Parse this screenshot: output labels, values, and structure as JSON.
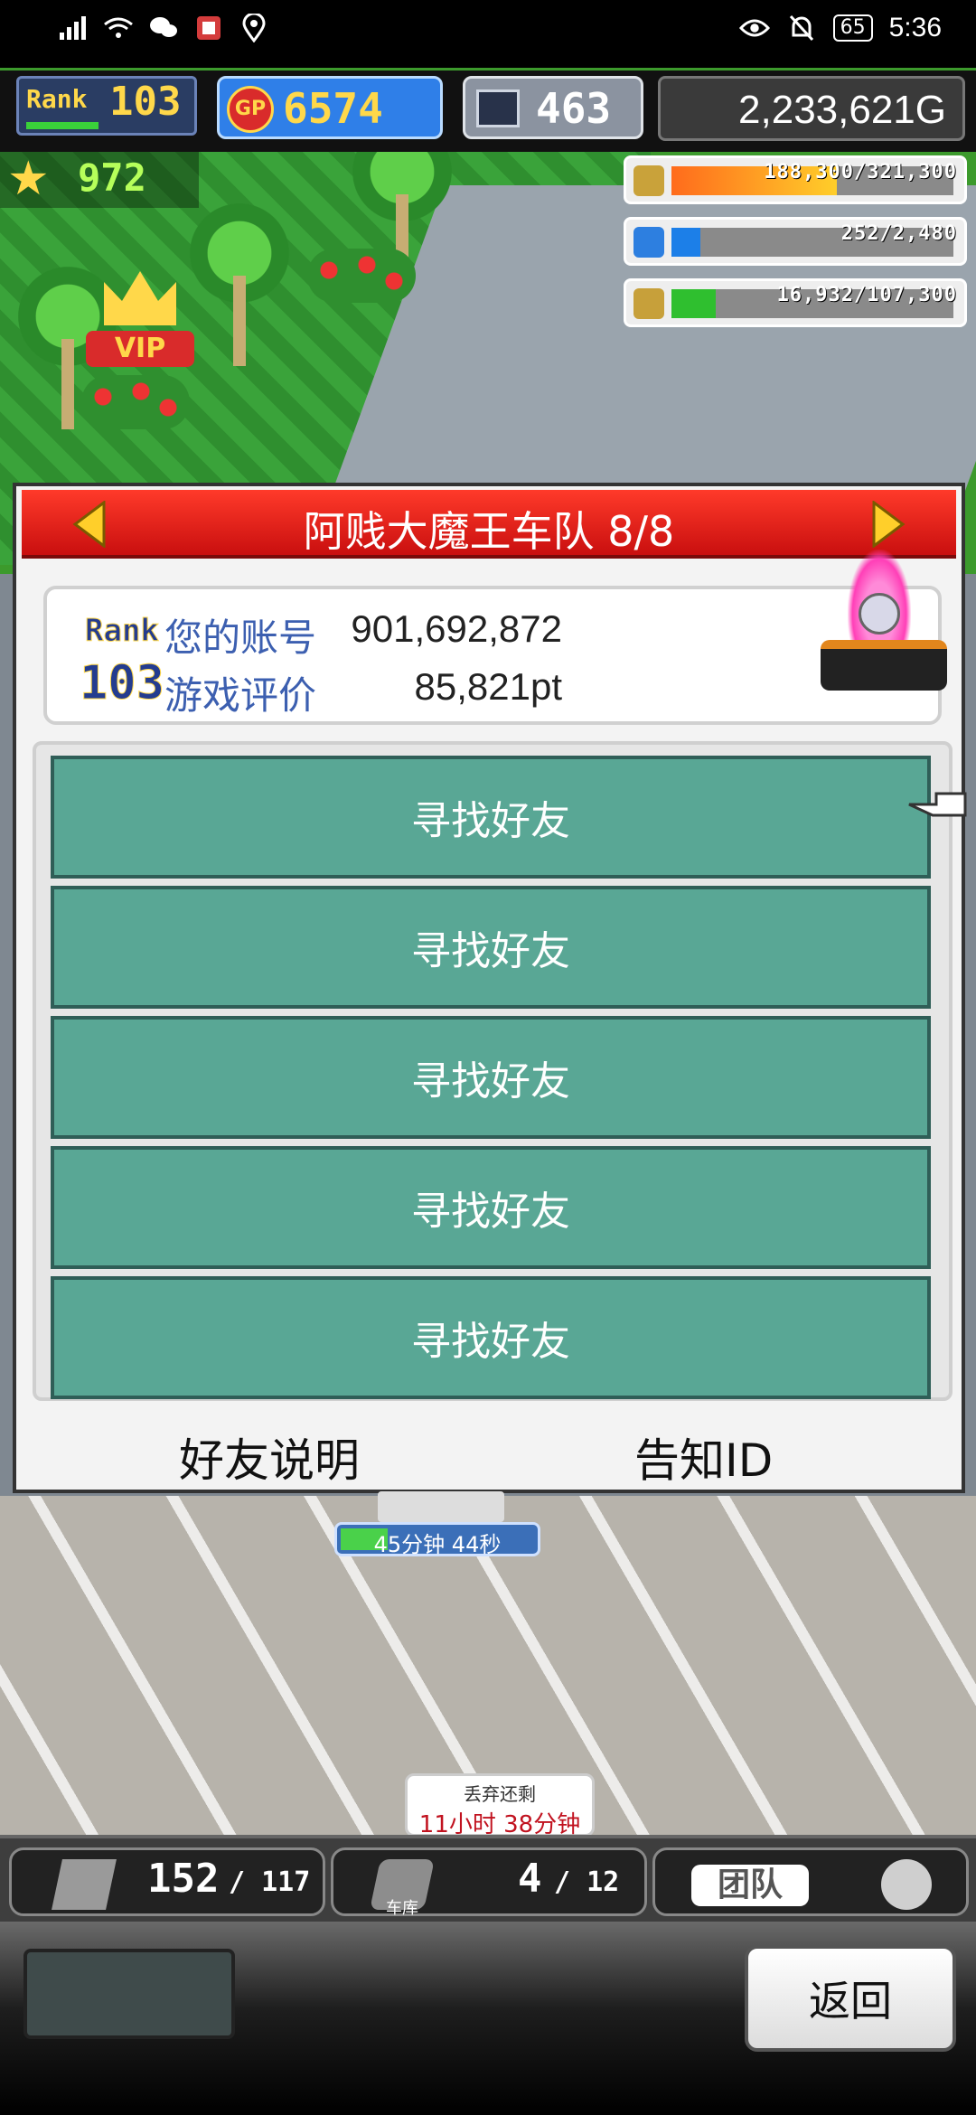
{
  "status_bar": {
    "network": "4G",
    "battery": "65",
    "time": "5:36"
  },
  "hud": {
    "rank_label": "Rank",
    "rank_value": "103",
    "gp_label": "GP",
    "gp_value": "6574",
    "research_value": "463",
    "money": "2,233,621G",
    "stars": "972",
    "resources": [
      {
        "icon": "barrel-icon",
        "value": "188,300/321,300",
        "fill": 0.586,
        "color": "#e85c1c"
      },
      {
        "icon": "fuel-icon",
        "value": "252/2,480",
        "fill": 0.102,
        "color": "#1c7fe8"
      },
      {
        "icon": "wheat-icon",
        "value": "16,932/107,300",
        "fill": 0.158,
        "color": "#2fbf2f"
      }
    ],
    "vip_label": "VIP"
  },
  "dialog": {
    "title": "阿贱大魔王车队 8/8",
    "rank_label": "Rank",
    "rank_value": "103",
    "account_label": "您的账号",
    "account_value": "901,692,872",
    "rating_label": "游戏评价",
    "rating_value": "85,821pt",
    "friend_slots": [
      {
        "label": "寻找好友"
      },
      {
        "label": "寻找好友"
      },
      {
        "label": "寻找好友"
      },
      {
        "label": "寻找好友"
      },
      {
        "label": "寻找好友"
      }
    ],
    "footer_left": "好友说明",
    "footer_right": "告知ID"
  },
  "map": {
    "timer_text": "45分钟 44秒",
    "bubble_line1": "丢弃还剩",
    "bubble_line2": "11小时 38分钟"
  },
  "bottom_bar": {
    "storage_value": "152",
    "storage_max": "/ 117",
    "garage_label": "车库",
    "garage_value": "4",
    "garage_max": "/ 12",
    "team_label": "团队"
  },
  "bottom_panel": {
    "back_label": "返回"
  },
  "colors": {
    "header_red": "#e31b12",
    "slot_teal": "#59a795",
    "label_blue": "#3c5fb0"
  }
}
